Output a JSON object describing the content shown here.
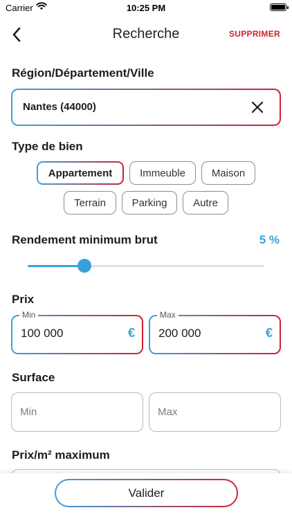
{
  "status_bar": {
    "carrier": "Carrier",
    "time": "10:25 PM"
  },
  "nav": {
    "title": "Recherche",
    "delete_label": "SUPPRIMER"
  },
  "location": {
    "label": "Région/Département/Ville",
    "value": "Nantes (44000)"
  },
  "property_type": {
    "label": "Type de bien",
    "options": [
      "Appartement",
      "Immeuble",
      "Maison",
      "Terrain",
      "Parking",
      "Autre"
    ],
    "selected": "Appartement"
  },
  "yield": {
    "label": "Rendement minimum brut",
    "value_text": "5 %",
    "slider_fraction": 0.24
  },
  "price": {
    "label": "Prix",
    "min": {
      "legend": "Min",
      "value": "100 000",
      "suffix": "€"
    },
    "max": {
      "legend": "Max",
      "value": "200 000",
      "suffix": "€"
    }
  },
  "surface": {
    "label": "Surface",
    "min_placeholder": "Min",
    "max_placeholder": "Max"
  },
  "price_per_m2": {
    "label": "Prix/m² maximum"
  },
  "submit_label": "Valider",
  "colors": {
    "accent_blue": "#3aa0dc",
    "accent_red": "#d0202e"
  }
}
